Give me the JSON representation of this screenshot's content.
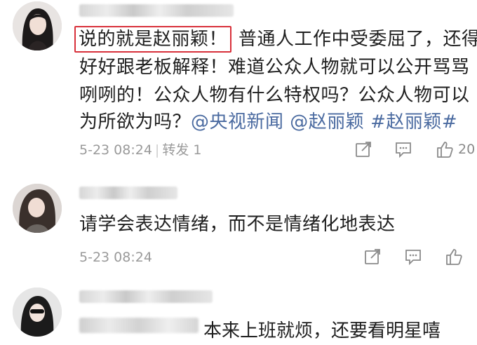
{
  "comments": [
    {
      "highlighted": "说的就是赵丽颖！",
      "line1_rest": "普通人工作中受委屈了，还得",
      "line2": "好好跟老板解释！难道公众人物就可以公开骂骂",
      "line3": "咧咧的！公众人物有什么特权吗？公众人物可以",
      "line4_text": "为所欲为吗？",
      "mentions": [
        "@央视新闻",
        "@赵丽颖",
        "#赵丽颖#"
      ],
      "timestamp": "5-23 08:24",
      "repost": "转发 1",
      "likes": "20"
    },
    {
      "text": "请学会表达情绪，而不是情绪化地表达",
      "timestamp": "5-23 08:24"
    },
    {
      "partial_text": "本来上班就烦，还要看明星嘻"
    }
  ],
  "colors": {
    "link": "#4a6aa0",
    "highlight_border": "#d8303a",
    "meta": "#9a9a9a"
  },
  "icons": [
    "share-icon",
    "comment-icon",
    "like-icon"
  ]
}
